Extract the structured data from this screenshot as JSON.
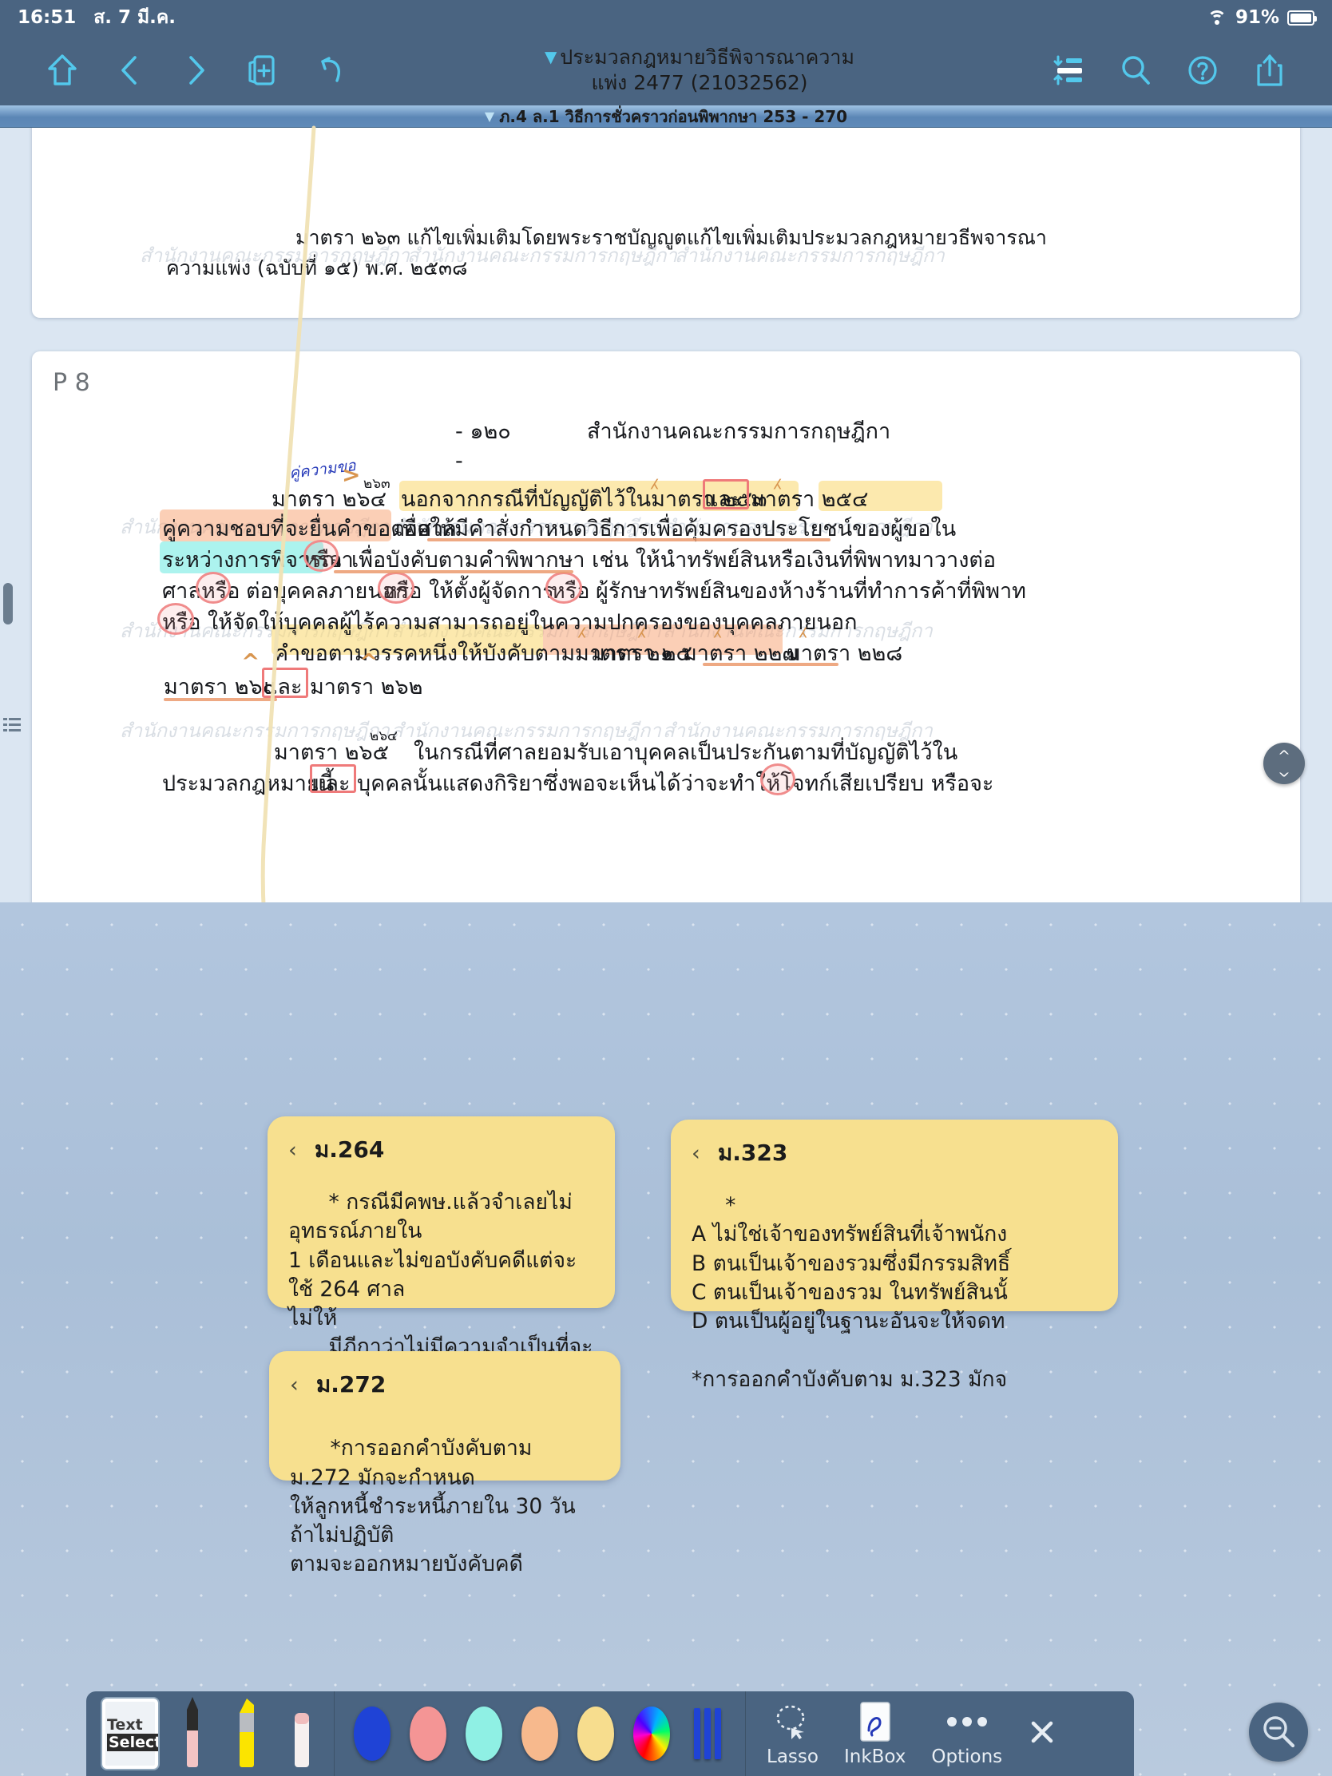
{
  "statusbar": {
    "time": "16:51",
    "date": "ส. 7 มี.ค.",
    "battery_percent": "91%",
    "wifi_icon": "wifi-icon",
    "battery_icon": "battery-icon"
  },
  "toolbar": {
    "left_icons": [
      "home-icon",
      "back-icon",
      "forward-icon",
      "add-page-icon",
      "undo-icon"
    ],
    "right_icons": [
      "outline-icon",
      "search-icon",
      "help-icon",
      "share-icon"
    ],
    "title_line1": "ประมวลกฎหมายวิธีพิจารณาความ",
    "title_line2": "แพ่ง 2477 (21032562)",
    "title_triangle": "▼"
  },
  "breadcrumb": {
    "triangle": "▼",
    "label": "ภ.4 ล.1 วิธีการชั่วคราวก่อนพิพากษา 253 - 270"
  },
  "document": {
    "page_label": "P 8",
    "watermark_text": "สำนักงานคณะกรรมการกฤษฎีกา",
    "prev_page_lines": [
      "มาตรา ๒๖๓ แก้ไขเพิ่มเติมโดยพระราชบัญญูตแก้ไขเพิ่มเติมประมวลกฎหมายวธีพจารณา",
      "ความแพ่ง (ฉบับที่ ๑๕) พ.ศ. ๒๕๓๘"
    ],
    "page_header_dash": "- ๑๒๐",
    "page_header_office": "สำนักงานคณะกรรมการกฤษฎีกา",
    "dash_small": "-",
    "lines": [
      {
        "id": "l1a",
        "text": "มาตรา ๒๖๔"
      },
      {
        "id": "l1sup",
        "text": "๒๖๓"
      },
      {
        "id": "l1b",
        "text": "นอกจากกรณีที่บัญญัติไว้ในมาตรา ๒๕๓"
      },
      {
        "id": "l1c",
        "text": "และ"
      },
      {
        "id": "l1d",
        "text": "มาตรา ๒๕๔"
      },
      {
        "id": "l2a",
        "text": "คู่ความชอบที่จะยื่นคำขอต่อศาล"
      },
      {
        "id": "l2b",
        "text": "เพื่อให้มีคำสั่งกำหนดวิธีการเพื่อคุ้มครองประโยชน์ของผู้ขอใน"
      },
      {
        "id": "l3a",
        "text": "ระหว่างการพิจารณา"
      },
      {
        "id": "l3b",
        "text": "หรือ"
      },
      {
        "id": "l3c",
        "text": "เพื่อบังคับตามคำพิพากษา เช่น ให้นำทรัพย์สินหรือเงินที่พิพาทมาวางต่อ"
      },
      {
        "id": "l4a",
        "text": "ศาล"
      },
      {
        "id": "l4b",
        "text": "หรือ"
      },
      {
        "id": "l4c",
        "text": "ต่อบุคคลภายนอก"
      },
      {
        "id": "l4d",
        "text": "หรือ"
      },
      {
        "id": "l4e",
        "text": "ให้ตั้งผู้จัดการ"
      },
      {
        "id": "l4f",
        "text": "หรือ"
      },
      {
        "id": "l4g",
        "text": "ผู้รักษาทรัพย์สินของห้างร้านที่ทำการค้าที่พิพาท"
      },
      {
        "id": "l5a",
        "text": "หรือ"
      },
      {
        "id": "l5b",
        "text": "ให้จัดให้บุคคลผู้ไร้ความสามารถอยู่ในความปกครองของบุคคลภายนอก"
      },
      {
        "id": "l6a",
        "text": "คำขอตามวรรคหนึ่งให้บังคับตามมาตรา ๒๑"
      },
      {
        "id": "l6b",
        "text": "มาตรา ๒๕"
      },
      {
        "id": "l6c",
        "text": "มาตรา ๒๒๗"
      },
      {
        "id": "l6d",
        "text": "มาตรา ๒๒๘"
      },
      {
        "id": "l7a",
        "text": "มาตรา ๒๖๐"
      },
      {
        "id": "l7b",
        "text": "และ"
      },
      {
        "id": "l7c",
        "text": "มาตรา ๒๖๒"
      },
      {
        "id": "l8a",
        "text": "มาตรา ๒๖๕"
      },
      {
        "id": "l8sup",
        "text": "๒๖๔"
      },
      {
        "id": "l8b",
        "text": "ในกรณีที่ศาลยอมรับเอาบุคคลเป็นประกันตามที่บัญญัติไว้ใน"
      },
      {
        "id": "l9a",
        "text": "ประมวลกฎหมายนี้"
      },
      {
        "id": "l9b",
        "text": "และ"
      },
      {
        "id": "l9c",
        "text": "บุคคลนั้นแสดงกิริยาซึ่งพอจะเห็นได้ว่าจะทำให้โจทก์เสียเปรียบ หรือจะ"
      }
    ],
    "ink_note": "คู่ความขอ",
    "scroll_pill_icon": "scroll-updown-icon"
  },
  "notes": [
    {
      "id": "note-264",
      "chevron": "‹",
      "title": "ม.264",
      "body": "      * กรณีมีคพษ.แล้วจำเลยไม่อุทธรณ์ภายใน\n1 เดือนและไม่ขอบังคับคดีแต่จะใช้ 264 ศาล\nไม่ให้\n      มีฎีกาว่าไม่มีความจำเป็นที่จะต้องใช้วิธีการ\nชั่วคราวอีกแล้ว จำหน่ายอุทธรณ์ โดยอ้างอิงวิ\nแพ่งทั้งประมวลเป็นหลักการ"
    },
    {
      "id": "note-323",
      "chevron": "‹",
      "title": "ม.323",
      "body": "     *\nA ไม่ใช่เจ้าของทรัพย์สินที่เจ้าพนักง\nB ตนเป็นเจ้าของรวมซึ่งมีกรรมสิทธิ์\nC ตนเป็นเจ้าของรวม ในทรัพย์สินนั้\nD ตนเป็นผู้อยู่ในฐานะอันจะให้จดท\n\n*การออกคำบังคับตาม ม.323 มักจ"
    },
    {
      "id": "note-272",
      "chevron": "‹",
      "title": "ม.272",
      "body": "\n      *การออกคำบังคับตาม ม.272 มักจะกำหนด\nให้ลูกหนี้ชำระหนี้ภายใน 30 วัน ถ้าไม่ปฏิบัติ\nตามจะออกหมายบังคับคดี"
    }
  ],
  "pentoolbar": {
    "text_select": {
      "line1": "Text",
      "line2": "Select",
      "name": "text-select-tool"
    },
    "tools": [
      "pencil-tool",
      "highlighter-tool",
      "eraser-tool"
    ],
    "colors": [
      "#1f43d6",
      "#f49595",
      "#8ff0e4",
      "#f7b98d",
      "#f7dd8e",
      "rainbow",
      "stripes"
    ],
    "actions": [
      {
        "label": "Lasso",
        "icon": "lasso-icon"
      },
      {
        "label": "InkBox",
        "icon": "inkbox-icon"
      },
      {
        "label": "Options",
        "icon": "ellipsis-icon"
      },
      {
        "label": "",
        "icon": "close-icon"
      }
    ],
    "magnifier_icon": "zoom-out-icon"
  },
  "colors": {
    "chrome": "#4a6481",
    "accent": "#53c8ec",
    "canvas": "#b2c6de",
    "note": "#f7e08f",
    "highlight_yellow": "#fadb7c",
    "highlight_orange": "#f8a87a",
    "highlight_cyan": "#8ceee8",
    "ink_red": "#f08c8c"
  }
}
